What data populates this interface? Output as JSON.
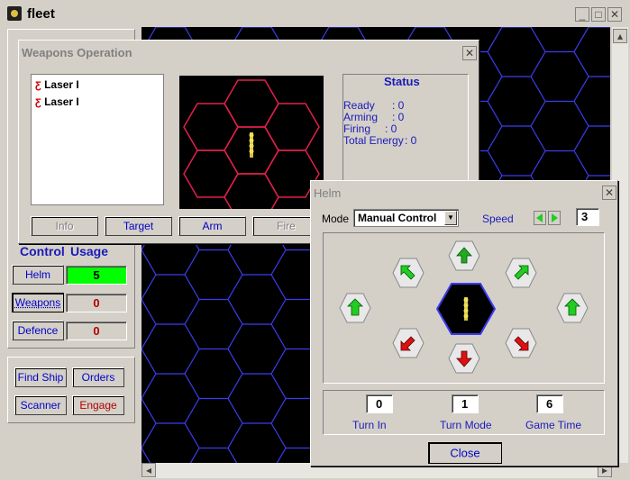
{
  "main": {
    "title": "fleet",
    "control_header": "Control",
    "usage_header": "Usage",
    "controls": [
      {
        "label": "Helm",
        "value": "5"
      },
      {
        "label": "Weapons",
        "value": "0"
      },
      {
        "label": "Defence",
        "value": "0"
      }
    ],
    "buttons": {
      "find_ship": "Find Ship",
      "orders": "Orders",
      "scanner": "Scanner",
      "engage": "Engage"
    }
  },
  "weapons": {
    "title": "Weapons Operation",
    "list": [
      "Laser I",
      "Laser I"
    ],
    "status_title": "Status",
    "status": [
      {
        "label": "Ready",
        "value": ": 0"
      },
      {
        "label": "Arming",
        "value": ": 0"
      },
      {
        "label": "Firing",
        "value": ": 0"
      },
      {
        "label": "Total Energy",
        "value": ": 0"
      }
    ],
    "buttons": {
      "info": "Info",
      "target": "Target",
      "arm": "Arm",
      "fire": "Fire"
    }
  },
  "helm": {
    "title": "Helm",
    "mode_label": "Mode",
    "mode_value": "Manual Control",
    "speed_label": "Speed",
    "speed_value": "3",
    "turn_in_value": "0",
    "turn_in_label": "Turn In",
    "turn_mode_value": "1",
    "turn_mode_label": "Turn Mode",
    "game_time_value": "6",
    "game_time_label": "Game Time",
    "close_label": "Close"
  },
  "colors": {
    "hex_blue": "#3c3cf0",
    "hex_red": "#e0204a",
    "usage_green": "#00ff00",
    "arrow_green": "#33cc33",
    "arrow_red": "#dd1111"
  }
}
